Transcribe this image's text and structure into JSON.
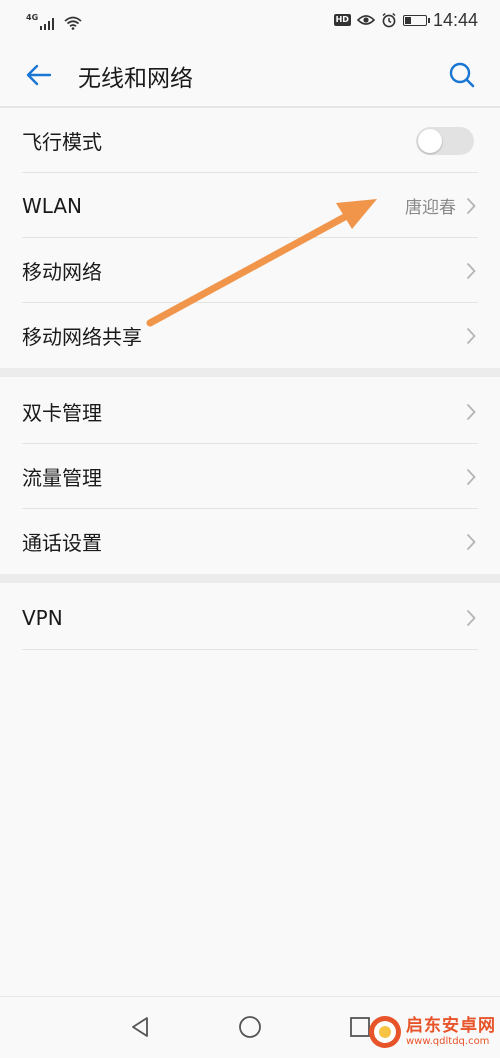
{
  "status_bar": {
    "network": "4G",
    "time": "14:44",
    "hd_badge": "HD",
    "battery_level": 0.3,
    "icons": [
      "signal-icon",
      "wifi-icon",
      "hd-icon",
      "eye-comfort-icon",
      "alarm-icon",
      "battery-icon"
    ]
  },
  "app_bar": {
    "title": "无线和网络",
    "back_icon": "back-arrow-icon",
    "search_icon": "search-icon",
    "accent_color": "#1976d2"
  },
  "groups": [
    {
      "items": [
        {
          "label": "飞行模式",
          "type": "toggle",
          "on": false
        },
        {
          "label": "WLAN",
          "type": "nav",
          "value": "唐迎春"
        },
        {
          "label": "移动网络",
          "type": "nav"
        },
        {
          "label": "移动网络共享",
          "type": "nav"
        }
      ]
    },
    {
      "items": [
        {
          "label": "双卡管理",
          "type": "nav"
        },
        {
          "label": "流量管理",
          "type": "nav"
        },
        {
          "label": "通话设置",
          "type": "nav"
        }
      ]
    },
    {
      "items": [
        {
          "label": "VPN",
          "type": "nav"
        }
      ]
    }
  ],
  "annotation": {
    "type": "arrow",
    "color": "#f0954a",
    "points_to": "WLAN"
  },
  "nav_bar": {
    "icons": [
      "nav-back-icon",
      "nav-home-icon",
      "nav-recents-icon"
    ]
  },
  "watermark": {
    "title": "启东安卓网",
    "url": "www.qdltdq.com",
    "color": "#e8542a"
  }
}
